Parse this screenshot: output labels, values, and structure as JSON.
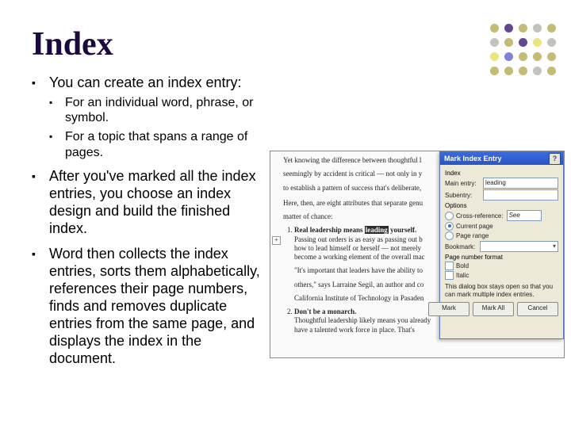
{
  "title": "Index",
  "bullets": {
    "b1": "You can create an index entry:",
    "b1a": "For an individual word, phrase, or symbol.",
    "b1b": "For a topic that spans a range of pages.",
    "b2": "After you've marked all the index entries, you choose an index design and build the finished index.",
    "b3": "Word then collects the index entries, sorts them alphabetically, references their page numbers, finds and removes duplicate entries from the same page, and displays the index in the document."
  },
  "doc": {
    "p1": "Yet knowing the difference between thoughtful l",
    "p2": "seemingly by accident is critical — not only in y",
    "p3": "to establish a pattern of success that's deliberate,",
    "p4": "Here, then, are eight attributes that separate genu",
    "p5": "matter of chance:",
    "li1": "Real leadership means ",
    "li1h": "leading",
    "li1t": " yourself.",
    "li1d1": "Passing out orders is as easy as passing out b",
    "li1d2": "how to lead himself or herself — not merely",
    "li1d3": "become a working element of the overall mac",
    "q1": "\"It's important that leaders have the ability to",
    "q2": "others,\" says Larraine Segil, an author and co",
    "q3": "California Institute of Technology in Pasaden",
    "li2": "Don't be a monarch.",
    "li2d": "Thoughtful leadership likely means you already have a talented work force in place. That's",
    "expand": "+"
  },
  "dlg": {
    "title": "Mark Index Entry",
    "help": "?",
    "sect_index": "Index",
    "main_entry_lbl": "Main entry:",
    "main_entry_val": "leading",
    "sub_lbl": "Subentry:",
    "sub_val": "",
    "sect_options": "Options",
    "opt_xref": "Cross-reference:",
    "opt_xref_val": "See",
    "opt_cur": "Current page",
    "opt_range": "Page range",
    "bookmark_lbl": "Bookmark:",
    "bookmark_val": "",
    "sect_fmt": "Page number format",
    "chk_bold": "Bold",
    "chk_italic": "Italic",
    "note": "This dialog box stays open so that you can mark multiple index entries.",
    "btn_mark": "Mark",
    "btn_markall": "Mark All",
    "btn_cancel": "Cancel"
  }
}
